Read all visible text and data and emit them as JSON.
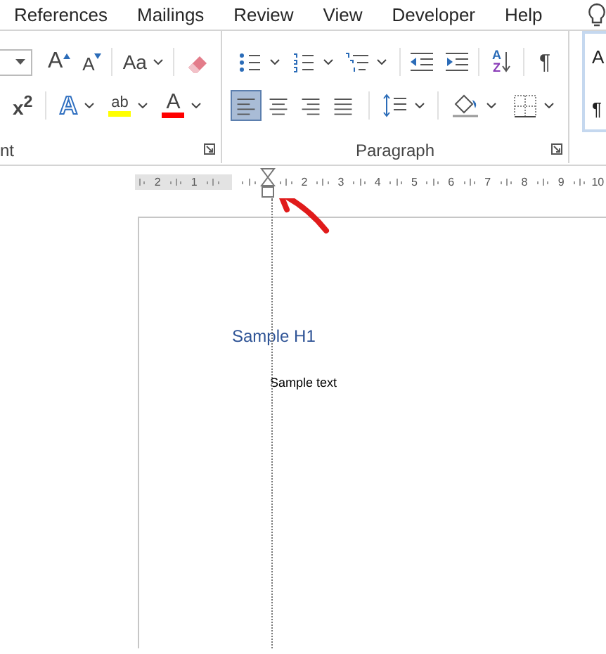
{
  "menu_tabs": [
    {
      "label": "References"
    },
    {
      "label": "Mailings"
    },
    {
      "label": "Review"
    },
    {
      "label": "View"
    },
    {
      "label": "Developer"
    },
    {
      "label": "Help"
    }
  ],
  "ribbon": {
    "font_group": {
      "label": "nt",
      "grow_glyph": "A",
      "shrink_glyph": "A",
      "case_glyph": "Aa",
      "superscript": "x$^{2}$",
      "effects_glyph": "A",
      "highlight_glyph": "ab",
      "color_glyph": "A"
    },
    "paragraph_group": {
      "label": "Paragraph",
      "sort_glyphs": [
        "A",
        "Z"
      ],
      "pilcrow": "¶",
      "alignment": [
        {
          "kind": "left",
          "selected": true
        },
        {
          "kind": "center",
          "selected": false
        },
        {
          "kind": "right",
          "selected": false
        },
        {
          "kind": "justify",
          "selected": false
        }
      ]
    },
    "styles_gallery": {
      "items": [
        "A",
        "¶"
      ]
    }
  },
  "ruler": {
    "left_numbers": [
      "2",
      "1"
    ],
    "right_numbers": [
      "2",
      "3",
      "4",
      "5",
      "6",
      "7",
      "8",
      "9",
      "10"
    ]
  },
  "document": {
    "heading": "Sample H1",
    "body": "Sample text"
  }
}
